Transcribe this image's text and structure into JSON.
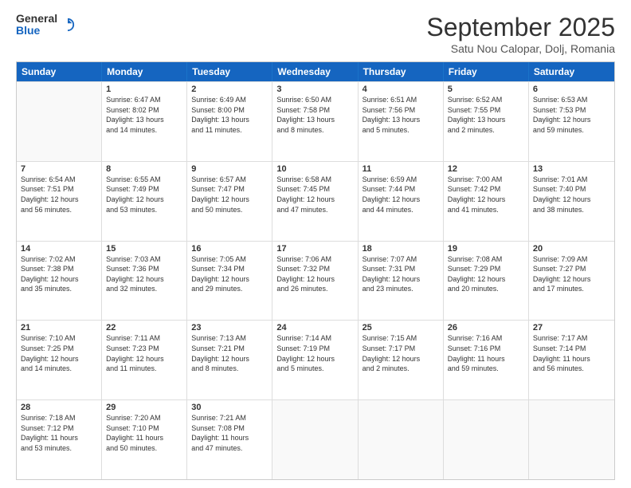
{
  "logo": {
    "general": "General",
    "blue": "Blue"
  },
  "header": {
    "month": "September 2025",
    "location": "Satu Nou Calopar, Dolj, Romania"
  },
  "days": [
    "Sunday",
    "Monday",
    "Tuesday",
    "Wednesday",
    "Thursday",
    "Friday",
    "Saturday"
  ],
  "weeks": [
    [
      {
        "day": "",
        "info": ""
      },
      {
        "day": "1",
        "info": "Sunrise: 6:47 AM\nSunset: 8:02 PM\nDaylight: 13 hours\nand 14 minutes."
      },
      {
        "day": "2",
        "info": "Sunrise: 6:49 AM\nSunset: 8:00 PM\nDaylight: 13 hours\nand 11 minutes."
      },
      {
        "day": "3",
        "info": "Sunrise: 6:50 AM\nSunset: 7:58 PM\nDaylight: 13 hours\nand 8 minutes."
      },
      {
        "day": "4",
        "info": "Sunrise: 6:51 AM\nSunset: 7:56 PM\nDaylight: 13 hours\nand 5 minutes."
      },
      {
        "day": "5",
        "info": "Sunrise: 6:52 AM\nSunset: 7:55 PM\nDaylight: 13 hours\nand 2 minutes."
      },
      {
        "day": "6",
        "info": "Sunrise: 6:53 AM\nSunset: 7:53 PM\nDaylight: 12 hours\nand 59 minutes."
      }
    ],
    [
      {
        "day": "7",
        "info": "Sunrise: 6:54 AM\nSunset: 7:51 PM\nDaylight: 12 hours\nand 56 minutes."
      },
      {
        "day": "8",
        "info": "Sunrise: 6:55 AM\nSunset: 7:49 PM\nDaylight: 12 hours\nand 53 minutes."
      },
      {
        "day": "9",
        "info": "Sunrise: 6:57 AM\nSunset: 7:47 PM\nDaylight: 12 hours\nand 50 minutes."
      },
      {
        "day": "10",
        "info": "Sunrise: 6:58 AM\nSunset: 7:45 PM\nDaylight: 12 hours\nand 47 minutes."
      },
      {
        "day": "11",
        "info": "Sunrise: 6:59 AM\nSunset: 7:44 PM\nDaylight: 12 hours\nand 44 minutes."
      },
      {
        "day": "12",
        "info": "Sunrise: 7:00 AM\nSunset: 7:42 PM\nDaylight: 12 hours\nand 41 minutes."
      },
      {
        "day": "13",
        "info": "Sunrise: 7:01 AM\nSunset: 7:40 PM\nDaylight: 12 hours\nand 38 minutes."
      }
    ],
    [
      {
        "day": "14",
        "info": "Sunrise: 7:02 AM\nSunset: 7:38 PM\nDaylight: 12 hours\nand 35 minutes."
      },
      {
        "day": "15",
        "info": "Sunrise: 7:03 AM\nSunset: 7:36 PM\nDaylight: 12 hours\nand 32 minutes."
      },
      {
        "day": "16",
        "info": "Sunrise: 7:05 AM\nSunset: 7:34 PM\nDaylight: 12 hours\nand 29 minutes."
      },
      {
        "day": "17",
        "info": "Sunrise: 7:06 AM\nSunset: 7:32 PM\nDaylight: 12 hours\nand 26 minutes."
      },
      {
        "day": "18",
        "info": "Sunrise: 7:07 AM\nSunset: 7:31 PM\nDaylight: 12 hours\nand 23 minutes."
      },
      {
        "day": "19",
        "info": "Sunrise: 7:08 AM\nSunset: 7:29 PM\nDaylight: 12 hours\nand 20 minutes."
      },
      {
        "day": "20",
        "info": "Sunrise: 7:09 AM\nSunset: 7:27 PM\nDaylight: 12 hours\nand 17 minutes."
      }
    ],
    [
      {
        "day": "21",
        "info": "Sunrise: 7:10 AM\nSunset: 7:25 PM\nDaylight: 12 hours\nand 14 minutes."
      },
      {
        "day": "22",
        "info": "Sunrise: 7:11 AM\nSunset: 7:23 PM\nDaylight: 12 hours\nand 11 minutes."
      },
      {
        "day": "23",
        "info": "Sunrise: 7:13 AM\nSunset: 7:21 PM\nDaylight: 12 hours\nand 8 minutes."
      },
      {
        "day": "24",
        "info": "Sunrise: 7:14 AM\nSunset: 7:19 PM\nDaylight: 12 hours\nand 5 minutes."
      },
      {
        "day": "25",
        "info": "Sunrise: 7:15 AM\nSunset: 7:17 PM\nDaylight: 12 hours\nand 2 minutes."
      },
      {
        "day": "26",
        "info": "Sunrise: 7:16 AM\nSunset: 7:16 PM\nDaylight: 11 hours\nand 59 minutes."
      },
      {
        "day": "27",
        "info": "Sunrise: 7:17 AM\nSunset: 7:14 PM\nDaylight: 11 hours\nand 56 minutes."
      }
    ],
    [
      {
        "day": "28",
        "info": "Sunrise: 7:18 AM\nSunset: 7:12 PM\nDaylight: 11 hours\nand 53 minutes."
      },
      {
        "day": "29",
        "info": "Sunrise: 7:20 AM\nSunset: 7:10 PM\nDaylight: 11 hours\nand 50 minutes."
      },
      {
        "day": "30",
        "info": "Sunrise: 7:21 AM\nSunset: 7:08 PM\nDaylight: 11 hours\nand 47 minutes."
      },
      {
        "day": "",
        "info": ""
      },
      {
        "day": "",
        "info": ""
      },
      {
        "day": "",
        "info": ""
      },
      {
        "day": "",
        "info": ""
      }
    ]
  ]
}
